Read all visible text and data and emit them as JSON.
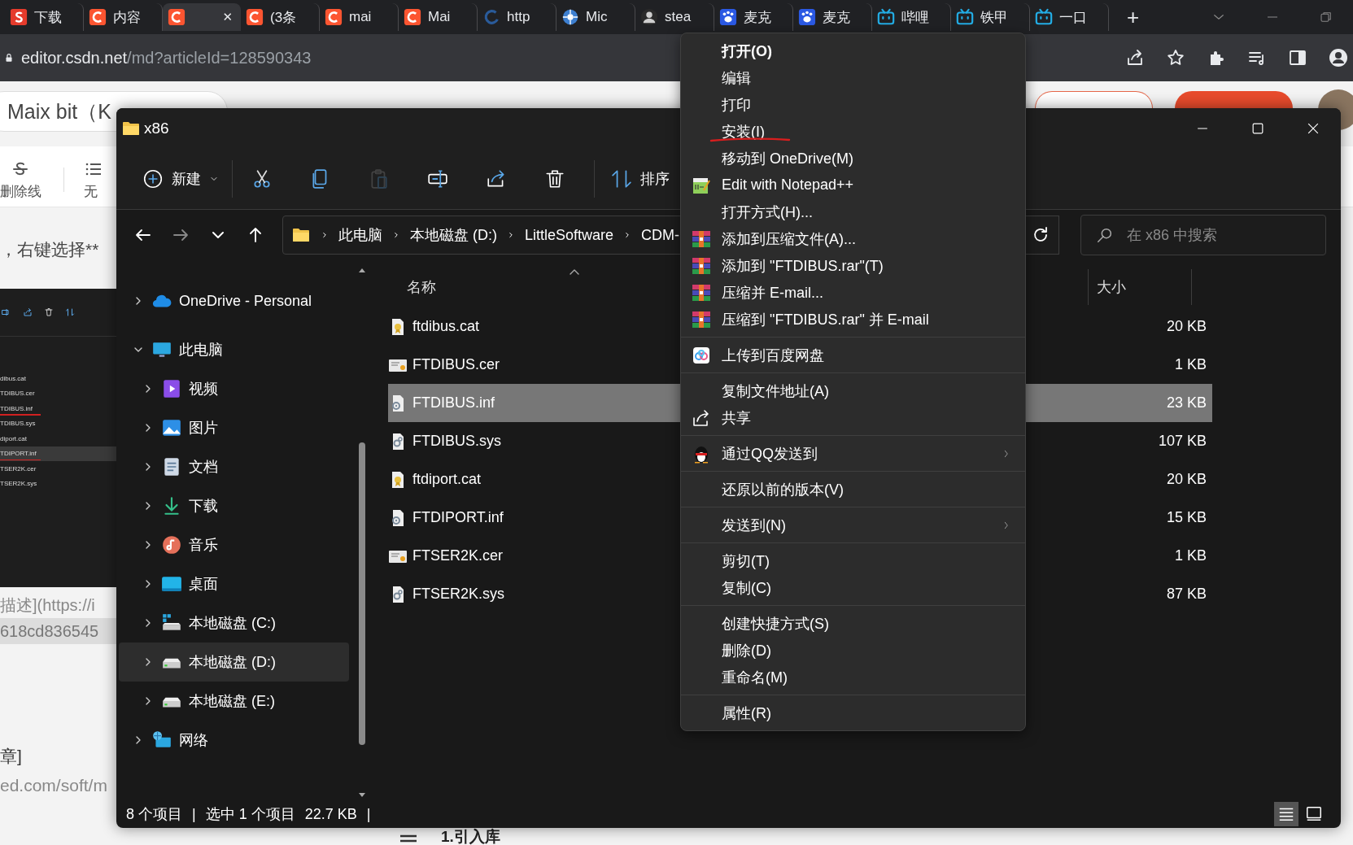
{
  "browser": {
    "tabs": [
      {
        "kind": "csdn-s",
        "label": "下载",
        "selected": false
      },
      {
        "kind": "csdn",
        "label": "内容",
        "selected": false
      },
      {
        "kind": "csdn",
        "selected": true,
        "close": "✕"
      },
      {
        "kind": "csdn",
        "label": "(3条",
        "selected": false
      },
      {
        "kind": "csdn",
        "label": "mai",
        "selected": false
      },
      {
        "kind": "csdn",
        "label": "Mai",
        "selected": false
      },
      {
        "kind": "arc",
        "label": "http",
        "selected": false
      },
      {
        "kind": "aperture",
        "label": "Mic",
        "selected": false
      },
      {
        "kind": "avatar",
        "label": "stea",
        "selected": false
      },
      {
        "kind": "paw",
        "label": "麦克",
        "selected": false
      },
      {
        "kind": "paw",
        "label": "麦克",
        "selected": false
      },
      {
        "kind": "tv",
        "label": "哔哩",
        "selected": false
      },
      {
        "kind": "tv",
        "label": "铁甲",
        "selected": false
      },
      {
        "kind": "tv",
        "label": "一口",
        "selected": false
      }
    ],
    "new_tab": "+",
    "address": {
      "host": "editor.csdn.net",
      "path": "/md?articleId=128590343"
    }
  },
  "editor_page": {
    "title_field": "Maix bit（K",
    "toolbar": [
      {
        "kind": "strike",
        "label": "删除线"
      },
      {
        "kind": "list",
        "label": "无"
      }
    ],
    "paragraph": "，右键选择**",
    "embedded_screenshot": {
      "files": [
        {
          "name": "dibus.cat",
          "selected": false,
          "underlined": false
        },
        {
          "name": "TDIBUS.cer",
          "selected": false,
          "underlined": false
        },
        {
          "name": "TDIBUS.inf",
          "selected": false,
          "underlined": true
        },
        {
          "name": "TDIBUS.sys",
          "selected": false,
          "underlined": false
        },
        {
          "name": "diport.cat",
          "selected": false,
          "underlined": false
        },
        {
          "name": "TDIPORT.inf",
          "selected": true,
          "underlined": true
        },
        {
          "name": "TSER2K.cer",
          "selected": false,
          "underlined": false
        },
        {
          "name": "TSER2K.sys",
          "selected": false,
          "underlined": false
        }
      ]
    },
    "code_lines": [
      {
        "text": "描述](https://i",
        "shaded": false
      },
      {
        "text": "618cd836545",
        "shaded": true
      }
    ],
    "lower_lines": [
      "章]",
      "ed.com/soft/m"
    ],
    "heading": "1.引入库"
  },
  "explorer": {
    "title": "x86",
    "toolbar": [
      {
        "kind": "new",
        "label": "新建",
        "disabled": false
      },
      {
        "kind": "cut",
        "disabled": false
      },
      {
        "kind": "copy",
        "disabled": false
      },
      {
        "kind": "paste",
        "disabled": true
      },
      {
        "kind": "rename",
        "disabled": false
      },
      {
        "kind": "share",
        "disabled": false
      },
      {
        "kind": "delete",
        "disabled": false
      },
      {
        "kind": "sort",
        "label": "排序",
        "disabled": false
      }
    ],
    "nav": [
      {
        "kind": "back",
        "disabled": false
      },
      {
        "kind": "forward",
        "disabled": true
      },
      {
        "kind": "recent",
        "disabled": false
      },
      {
        "kind": "up",
        "disabled": false
      }
    ],
    "breadcrumb": [
      "此电脑",
      "本地磁盘 (D:)",
      "LittleSoftware",
      "CDM-"
    ],
    "search": {
      "placeholder": "在 x86 中搜索"
    },
    "sidebar": [
      {
        "label": "OneDrive - Personal",
        "kind": "cloud",
        "expanded": false,
        "selected": false
      },
      {
        "label": "此电脑",
        "kind": "monitor",
        "expanded": true,
        "selected": false,
        "children": [
          {
            "label": "视频",
            "kind": "video",
            "expanded": false,
            "selected": false
          },
          {
            "label": "图片",
            "kind": "image",
            "expanded": false,
            "selected": false
          },
          {
            "label": "文档",
            "kind": "doc",
            "expanded": false,
            "selected": false
          },
          {
            "label": "下载",
            "kind": "download",
            "expanded": false,
            "selected": false
          },
          {
            "label": "音乐",
            "kind": "music",
            "expanded": false,
            "selected": false
          },
          {
            "label": "桌面",
            "kind": "desktop",
            "expanded": false,
            "selected": false
          },
          {
            "label": "本地磁盘 (C:)",
            "kind": "sysdrive",
            "expanded": false,
            "selected": false
          },
          {
            "label": "本地磁盘 (D:)",
            "kind": "drive",
            "expanded": false,
            "selected": true
          },
          {
            "label": "本地磁盘 (E:)",
            "kind": "drive",
            "expanded": false,
            "selected": false
          }
        ]
      },
      {
        "label": "网络",
        "kind": "network",
        "expanded": false,
        "selected": false
      }
    ],
    "columns": [
      "名称",
      "大小"
    ],
    "files": [
      {
        "name": "ftdibus.cat",
        "kind": "cat",
        "size": "20 KB",
        "selected": false
      },
      {
        "name": "FTDIBUS.cer",
        "kind": "cer",
        "size": "1 KB",
        "selected": false
      },
      {
        "name": "FTDIBUS.inf",
        "kind": "inf",
        "size": "23 KB",
        "selected": true
      },
      {
        "name": "FTDIBUS.sys",
        "kind": "sys",
        "size": "107 KB",
        "selected": false
      },
      {
        "name": "ftdiport.cat",
        "kind": "cat",
        "size": "20 KB",
        "selected": false
      },
      {
        "name": "FTDIPORT.inf",
        "kind": "inf",
        "size": "15 KB",
        "selected": false
      },
      {
        "name": "FTSER2K.cer",
        "kind": "cer",
        "size": "1 KB",
        "selected": false
      },
      {
        "name": "FTSER2K.sys",
        "kind": "sys",
        "size": "87 KB",
        "selected": false
      }
    ],
    "status": [
      "8 个项目",
      "|",
      "选中 1 个项目",
      "22.7 KB",
      "|"
    ],
    "views": [
      {
        "kind": "details",
        "selected": true
      },
      {
        "kind": "tiles",
        "selected": false
      }
    ]
  },
  "context_menu": {
    "items": [
      {
        "kind": "plain",
        "label": "打开(O)",
        "default": true,
        "annotated": false,
        "submenu": false
      },
      {
        "kind": "plain",
        "label": "编辑",
        "default": false,
        "annotated": false,
        "submenu": false
      },
      {
        "kind": "plain",
        "label": "打印",
        "default": false,
        "annotated": false,
        "submenu": false
      },
      {
        "kind": "plain",
        "label": "安装(I)",
        "default": false,
        "annotated": true,
        "submenu": false
      },
      {
        "kind": "plain",
        "label": "移动到 OneDrive(M)",
        "default": false,
        "annotated": false,
        "submenu": false
      },
      {
        "kind": "notepad",
        "label": "Edit with Notepad++",
        "default": false,
        "annotated": false,
        "submenu": false
      },
      {
        "kind": "plain",
        "label": "打开方式(H)...",
        "default": false,
        "annotated": false,
        "submenu": false
      },
      {
        "kind": "archive",
        "label": "添加到压缩文件(A)...",
        "default": false,
        "annotated": false,
        "submenu": false
      },
      {
        "kind": "archive",
        "label": "添加到 \"FTDIBUS.rar\"(T)",
        "default": false,
        "annotated": false,
        "submenu": false
      },
      {
        "kind": "archive",
        "label": "压缩并 E-mail...",
        "default": false,
        "annotated": false,
        "submenu": false
      },
      {
        "kind": "archive",
        "label": "压缩到 \"FTDIBUS.rar\" 并 E-mail",
        "default": false,
        "annotated": false,
        "submenu": false
      },
      {
        "kind": "separator"
      },
      {
        "kind": "cloudapp",
        "label": "上传到百度网盘",
        "default": false,
        "annotated": false,
        "submenu": false
      },
      {
        "kind": "separator"
      },
      {
        "kind": "plain",
        "label": "复制文件地址(A)",
        "default": false,
        "annotated": false,
        "submenu": false
      },
      {
        "kind": "share",
        "label": "共享",
        "default": false,
        "annotated": false,
        "submenu": false
      },
      {
        "kind": "separator"
      },
      {
        "kind": "penguin",
        "label": "通过QQ发送到",
        "default": false,
        "annotated": false,
        "submenu": true
      },
      {
        "kind": "separator"
      },
      {
        "kind": "plain",
        "label": "还原以前的版本(V)",
        "default": false,
        "annotated": false,
        "submenu": false
      },
      {
        "kind": "separator"
      },
      {
        "kind": "plain",
        "label": "发送到(N)",
        "default": false,
        "annotated": false,
        "submenu": true
      },
      {
        "kind": "separator"
      },
      {
        "kind": "plain",
        "label": "剪切(T)",
        "default": false,
        "annotated": false,
        "submenu": false
      },
      {
        "kind": "plain",
        "label": "复制(C)",
        "default": false,
        "annotated": false,
        "submenu": false
      },
      {
        "kind": "separator"
      },
      {
        "kind": "plain",
        "label": "创建快捷方式(S)",
        "default": false,
        "annotated": false,
        "submenu": false
      },
      {
        "kind": "plain",
        "label": "删除(D)",
        "default": false,
        "annotated": false,
        "submenu": false
      },
      {
        "kind": "plain",
        "label": "重命名(M)",
        "default": false,
        "annotated": false,
        "submenu": false
      },
      {
        "kind": "separator"
      },
      {
        "kind": "plain",
        "label": "属性(R)",
        "default": false,
        "annotated": false,
        "submenu": false
      }
    ]
  }
}
